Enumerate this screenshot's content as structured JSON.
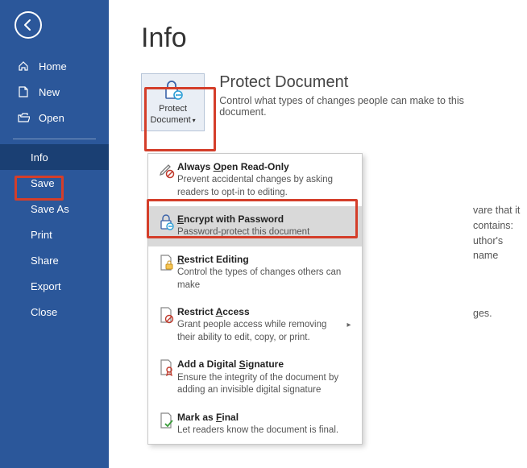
{
  "sidebar": {
    "items": [
      {
        "label": "Home"
      },
      {
        "label": "New"
      },
      {
        "label": "Open"
      },
      {
        "label": "Info"
      },
      {
        "label": "Save"
      },
      {
        "label": "Save As"
      },
      {
        "label": "Print"
      },
      {
        "label": "Share"
      },
      {
        "label": "Export"
      },
      {
        "label": "Close"
      }
    ]
  },
  "main": {
    "page_title": "Info",
    "protect_button_line1": "Protect",
    "protect_button_line2": "Document",
    "protect_heading": "Protect Document",
    "protect_desc": "Control what types of changes people can make to this document."
  },
  "menu": {
    "items": [
      {
        "title_pre": "Always ",
        "title_accel": "O",
        "title_post": "pen Read-Only",
        "desc": "Prevent accidental changes by asking readers to opt-in to editing."
      },
      {
        "title_pre": "",
        "title_accel": "E",
        "title_post": "ncrypt with Password",
        "desc": "Password-protect this document"
      },
      {
        "title_pre": "",
        "title_accel": "R",
        "title_post": "estrict Editing",
        "desc": "Control the types of changes others can make"
      },
      {
        "title_pre": "Restrict ",
        "title_accel": "A",
        "title_post": "ccess",
        "desc": "Grant people access while removing their ability to edit, copy, or print."
      },
      {
        "title_pre": "Add a Digital ",
        "title_accel": "S",
        "title_post": "ignature",
        "desc": "Ensure the integrity of the document by adding an invisible digital signature"
      },
      {
        "title_pre": "Mark as ",
        "title_accel": "F",
        "title_post": "inal",
        "desc": "Let readers know the document is final."
      }
    ]
  },
  "partial": {
    "line1a": "vare that it contains:",
    "line1b": "uthor's name",
    "line2": "ges."
  }
}
